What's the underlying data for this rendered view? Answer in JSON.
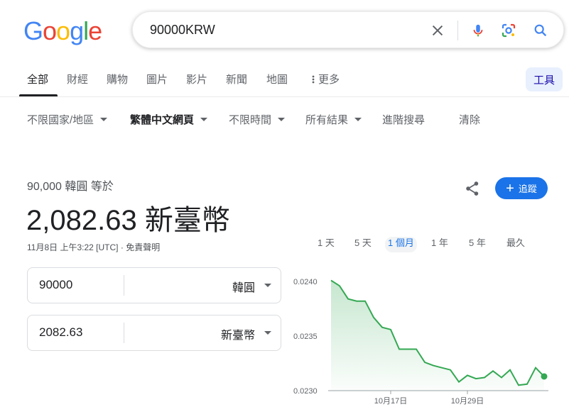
{
  "logo": {
    "letters": [
      "G",
      "o",
      "o",
      "g",
      "l",
      "e"
    ],
    "colors": [
      "#4285F4",
      "#EA4335",
      "#FBBC05",
      "#4285F4",
      "#34A853",
      "#EA4335"
    ]
  },
  "search": {
    "value": "90000KRW",
    "icons": [
      "close-icon",
      "mic-icon",
      "lens-icon",
      "search-icon"
    ]
  },
  "tabs": [
    {
      "label": "全部",
      "active": true
    },
    {
      "label": "財經"
    },
    {
      "label": "購物"
    },
    {
      "label": "圖片"
    },
    {
      "label": "影片"
    },
    {
      "label": "新聞"
    },
    {
      "label": "地圖"
    },
    {
      "label": "更多"
    }
  ],
  "tools_label": "工具",
  "filters": [
    {
      "label": "不限國家/地區"
    },
    {
      "label": "繁體中文網頁"
    },
    {
      "label": "不限時間"
    },
    {
      "label": "所有結果"
    },
    {
      "label": "進階搜尋"
    },
    {
      "label": "清除"
    }
  ],
  "converter": {
    "label": "90,000 韓圓 等於",
    "result": "2,082.63 新臺幣",
    "timestamp": "11月8日 上午3:22 [UTC]",
    "separator": "·",
    "disclaimer": "免責聲明",
    "follow_label": "追蹤",
    "from": {
      "amount": "90000",
      "currency": "韓圓"
    },
    "to": {
      "amount": "2082.63",
      "currency": "新臺幣"
    }
  },
  "ranges": [
    {
      "label": "1 天"
    },
    {
      "label": "5 天"
    },
    {
      "label": "1 個月",
      "active": true
    },
    {
      "label": "1 年"
    },
    {
      "label": "5 年"
    },
    {
      "label": "最久"
    }
  ],
  "colors": {
    "accent": "#1a73e8",
    "chart_line": "#34a853",
    "chart_fill": "#ceead6"
  },
  "chart_data": {
    "type": "area",
    "y_ticks": [
      "0.0240",
      "0.0235",
      "0.0230"
    ],
    "x_tick_labels": [
      "10月17日",
      "10月29日"
    ],
    "x_tick_index": [
      7,
      16
    ],
    "ylim": [
      0.023,
      0.024
    ],
    "values": [
      0.02401,
      0.02396,
      0.02384,
      0.02382,
      0.02382,
      0.02367,
      0.02358,
      0.02356,
      0.02338,
      0.02338,
      0.02338,
      0.02326,
      0.02323,
      0.02321,
      0.02319,
      0.02308,
      0.02314,
      0.02311,
      0.02312,
      0.02318,
      0.02312,
      0.02319,
      0.02305,
      0.02306,
      0.02321,
      0.02313
    ]
  }
}
